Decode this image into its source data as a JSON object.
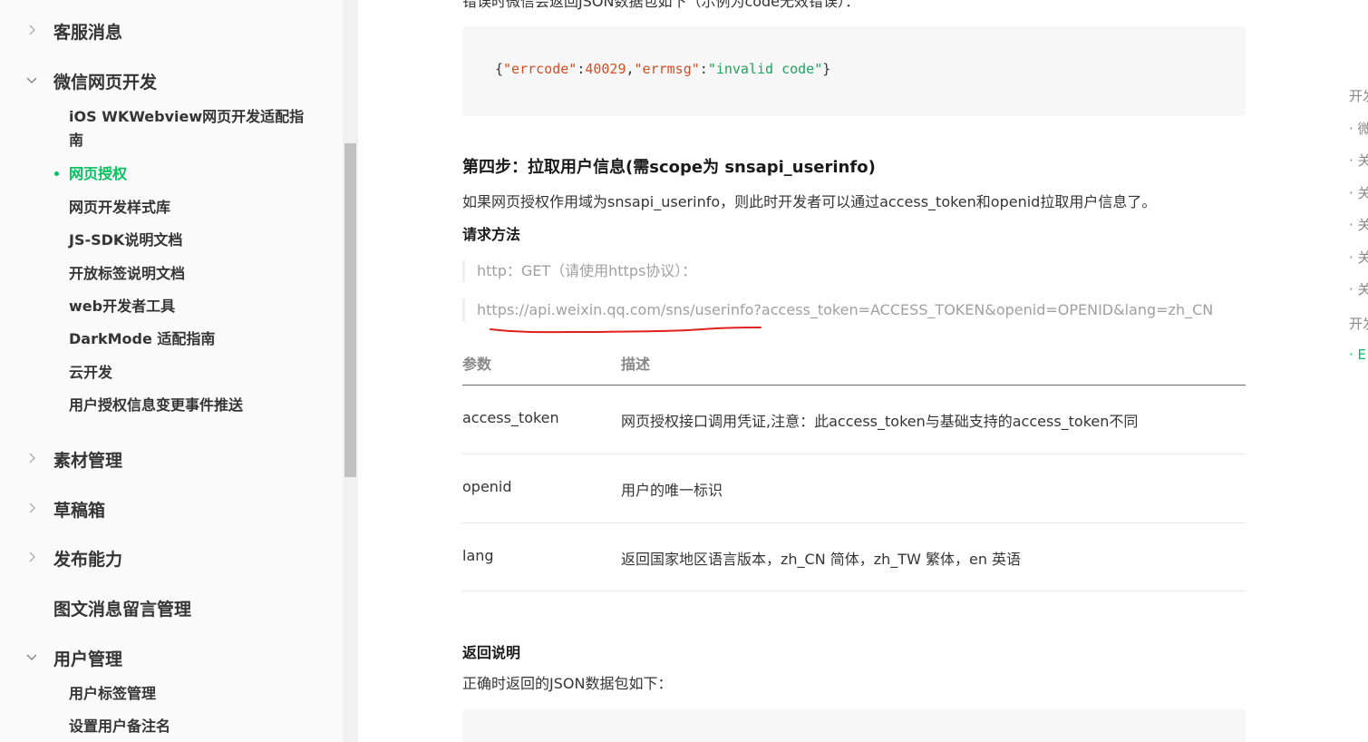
{
  "sidebar": {
    "sections": [
      {
        "label": "客服消息",
        "expanded": false
      },
      {
        "label": "微信网页开发",
        "expanded": true
      },
      {
        "label": "素材管理",
        "expanded": false
      },
      {
        "label": "草稿箱",
        "expanded": false
      },
      {
        "label": "发布能力",
        "expanded": false
      },
      {
        "label": "图文消息留言管理",
        "expanded": null
      },
      {
        "label": "用户管理",
        "expanded": true
      }
    ],
    "web_items": [
      "iOS WKWebview网页开发适配指",
      "南",
      "网页授权",
      "网页开发样式库",
      "JS-SDK说明文档",
      "开放标签说明文档",
      "web开发者工具",
      "DarkMode 适配指南",
      "云开发",
      "用户授权信息变更事件推送"
    ],
    "user_items": [
      "用户标签管理",
      "设置用户备注名"
    ],
    "active_color": "#07c160"
  },
  "main": {
    "top_line": "错误时微信会返回JSON数据包如下（示例为code无效错误）：",
    "code1": {
      "p1": "{",
      "k1": "\"errcode\"",
      "p2": ":",
      "v1": "40029",
      "p3": ",",
      "k2": "\"errmsg\"",
      "p4": ":",
      "v2": "\"invalid code\"",
      "p5": "}"
    },
    "step4_title": "第四步：拉取用户信息(需scope为 snsapi_userinfo)",
    "step4_desc": "如果网页授权作用域为snsapi_userinfo，则此时开发者可以通过access_token和openid拉取用户信息了。",
    "request_method_label": "请求方法",
    "http_line": "http：GET（请使用https协议）：",
    "url_line": "https://api.weixin.qq.com/sns/userinfo?access_token=ACCESS_TOKEN&openid=OPENID&lang=zh_CN",
    "table": {
      "headers": [
        "参数",
        "描述"
      ],
      "rows": [
        [
          "access_token",
          "网页授权接口调用凭证,注意：此access_token与基础支持的access_token不同"
        ],
        [
          "openid",
          "用户的唯一标识"
        ],
        [
          "lang",
          "返回国家地区语言版本，zh_CN 简体，zh_TW 繁体，en 英语"
        ]
      ]
    },
    "return_label": "返回说明",
    "return_desc": "正确时返回的JSON数据包如下："
  },
  "toc": {
    "items": [
      "开发",
      "· 微",
      "· 关",
      "· 关",
      "· 关",
      "· 关",
      "· 关",
      "开发",
      "· E"
    ]
  },
  "annotation_color": "#e0201c"
}
